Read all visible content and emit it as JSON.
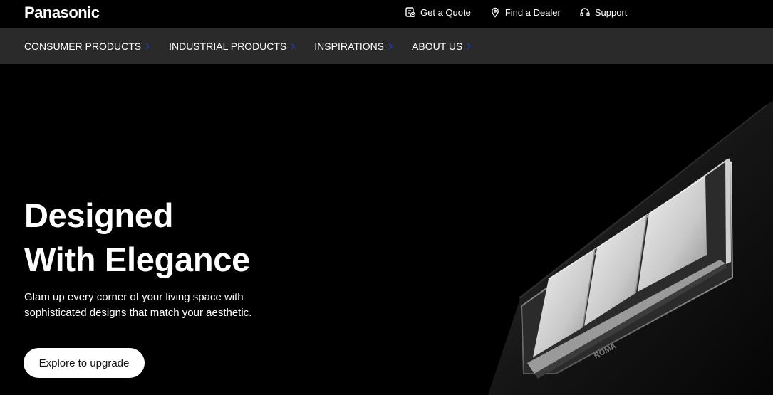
{
  "brand": {
    "logo": "Panasonic"
  },
  "utility_nav": [
    {
      "label": "Get a Quote",
      "icon": "quote-icon"
    },
    {
      "label": "Find a Dealer",
      "icon": "location-pin-icon"
    },
    {
      "label": "Support",
      "icon": "headset-icon"
    }
  ],
  "main_nav": [
    {
      "label": "CONSUMER PRODUCTS"
    },
    {
      "label": "INDUSTRIAL PRODUCTS"
    },
    {
      "label": "INSPIRATIONS"
    },
    {
      "label": "ABOUT US"
    }
  ],
  "hero": {
    "title_line1": "Designed",
    "title_line2": "With Elegance",
    "subtitle_line1": "Glam up every corner of your living space with",
    "subtitle_line2": "sophisticated designs that match your aesthetic.",
    "cta_label": "Explore to upgrade",
    "product_brand": "ROMA"
  },
  "colors": {
    "background": "#000000",
    "nav_background": "#2a2a2a",
    "chevron_accent": "#1f3aa8",
    "text": "#ffffff"
  }
}
